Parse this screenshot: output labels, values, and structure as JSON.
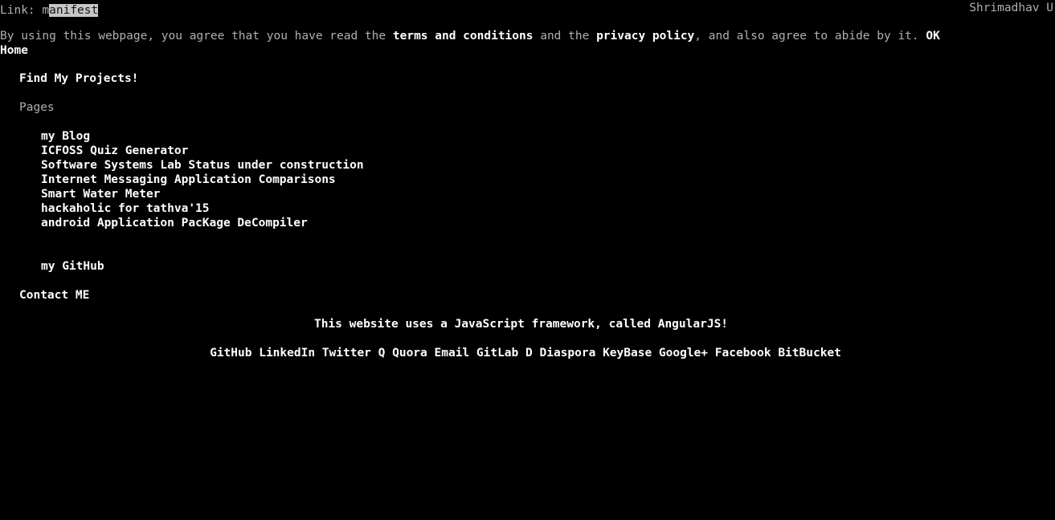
{
  "browser": {
    "status_prefix": "Link: ",
    "status_link_unselected": "m",
    "status_link_selected": "anifest",
    "user_label": "Shrimadhav U"
  },
  "consent_banner": {
    "text_1": "By using this webpage, you agree that you have read the ",
    "link_terms": "terms and conditions",
    "text_2": " and the ",
    "link_privacy": "privacy policy",
    "text_3": ", and also agree to abide by it. ",
    "ok_label": "OK"
  },
  "nav": {
    "home_label": "Home"
  },
  "main": {
    "heading": "Find My Projects!",
    "pages_label": "Pages",
    "pages": [
      {
        "label": "my Blog"
      },
      {
        "label": "ICFOSS Quiz Generator"
      },
      {
        "label": "Software Systems Lab Status under construction"
      },
      {
        "label": "Internet Messaging Application Comparisons"
      },
      {
        "label": "Smart Water Meter"
      },
      {
        "label": "hackaholic for tathva'15"
      },
      {
        "label": "android Application PacKage DeCompiler"
      }
    ],
    "github_label": "my GitHub",
    "contact_label": "Contact ME",
    "framework_note": "This website uses a JavaScript framework, called AngularJS!"
  },
  "footer": {
    "social_links": [
      {
        "label": "GitHub"
      },
      {
        "label": "LinkedIn"
      },
      {
        "label": "Twitter"
      },
      {
        "label": "Q"
      },
      {
        "label": "Quora"
      },
      {
        "label": "Email"
      },
      {
        "label": "GitLab"
      },
      {
        "label": "D"
      },
      {
        "label": "Diaspora"
      },
      {
        "label": "KeyBase"
      },
      {
        "label": "Google+"
      },
      {
        "label": "Facebook"
      },
      {
        "label": "BitBucket"
      }
    ],
    "separator": " "
  },
  "colors": {
    "background": "#000000",
    "text": "#ffffff",
    "dim_text": "#b0b0b0",
    "selection_background": "#c6c6c6",
    "selection_text": "#141414"
  }
}
